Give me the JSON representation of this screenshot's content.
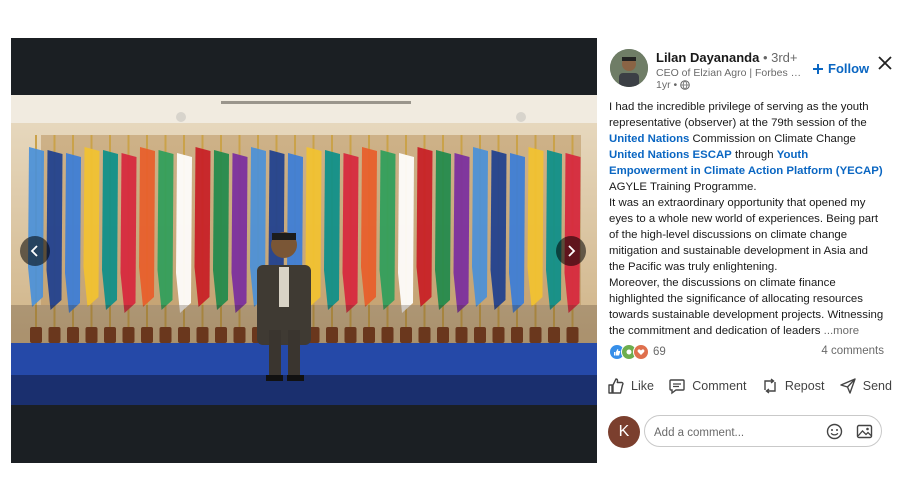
{
  "author": {
    "name": "Lilan Dayananda",
    "degree": "• 3rd+",
    "headline": "CEO of Elzian Agro | Forbes Unde...",
    "time": "1yr •"
  },
  "follow_label": "Follow",
  "post": {
    "p1_a": "I had the incredible privilege of serving as the youth representative (observer) at the 79th session of the ",
    "link_un": "United Nations",
    "p1_b": " Commission on Climate Change ",
    "link_escap": "United Nations ESCAP",
    "p1_c": " through ",
    "link_yecap": "Youth Empowerment in Climate Action Platform (YECAP)",
    "p1_d": " AGYLE Training Programme.",
    "p2": "It was an extraordinary opportunity that opened my eyes to a whole new world of experiences. Being part of the high-level discussions on climate change mitigation and sustainable development in Asia and the Pacific was truly enlightening.",
    "p3": "Moreover, the discussions on climate finance highlighted the significance of allocating resources towards sustainable development projects. Witnessing the commitment and dedication of leaders ",
    "more": "...more"
  },
  "reactions_count": "69",
  "comments_count": "4 comments",
  "actions": {
    "like": "Like",
    "comment": "Comment",
    "repost": "Repost",
    "send": "Send"
  },
  "comment": {
    "avatar_letter": "K",
    "placeholder": "Add a comment..."
  },
  "colors": {
    "accent": "#0a66c2",
    "backdrop": "#1b1f23",
    "stage": "#1f3a8a"
  },
  "icons": [
    "chevron-left-icon",
    "chevron-right-icon",
    "close-icon",
    "plus-icon",
    "globe-icon",
    "like-icon",
    "comment-icon",
    "repost-icon",
    "send-icon",
    "emoji-icon",
    "image-icon"
  ]
}
